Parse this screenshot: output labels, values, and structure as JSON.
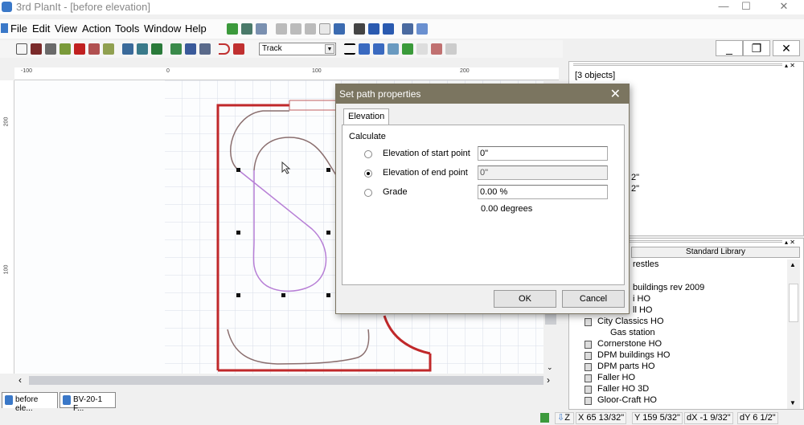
{
  "window": {
    "title": "3rd PlanIt - [before elevation]",
    "minimize": "—",
    "maximize": "☐",
    "close": "✕"
  },
  "menu": [
    "File",
    "Edit",
    "View",
    "Action",
    "Tools",
    "Window",
    "Help"
  ],
  "mdi": {
    "minimize": "_",
    "restore": "❐",
    "close": "✕"
  },
  "toolbar": {
    "layer_select": "Track"
  },
  "ruler": {
    "top": [
      "-100",
      "0",
      "100",
      "200"
    ],
    "left": [
      "200",
      "100"
    ]
  },
  "tabs": [
    "before ele...",
    "BV-20-1 F..."
  ],
  "props": {
    "header": "[3 objects]",
    "partial": [
      "2\"",
      "2\""
    ]
  },
  "library": {
    "title": "Standard Library",
    "items": [
      {
        "label": "restles",
        "child": false
      },
      {
        "label": "buildings rev 2009",
        "child": false
      },
      {
        "label": "i HO",
        "child": false
      },
      {
        "label": "ll HO",
        "child": false
      },
      {
        "label": "City Classics HO",
        "child": false
      },
      {
        "label": "Gas station",
        "child": true
      },
      {
        "label": "Cornerstone HO",
        "child": false
      },
      {
        "label": "DPM buildings HO",
        "child": false
      },
      {
        "label": "DPM parts HO",
        "child": false
      },
      {
        "label": "Faller HO",
        "child": false
      },
      {
        "label": "Faller HO 3D",
        "child": false
      },
      {
        "label": "Gloor-Craft HO",
        "child": false
      }
    ]
  },
  "status": {
    "x": "X 65 13/32\"",
    "y": "Y 159 5/32\"",
    "dx": "dX -1 9/32\"",
    "dy": "dY 6 1/2\"",
    "z": "Z"
  },
  "dialog": {
    "title": "Set path properties",
    "tab": "Elevation",
    "group": "Calculate",
    "rows": [
      {
        "label": "Elevation of start point",
        "value": "0\"",
        "selected": false
      },
      {
        "label": "Elevation of end point",
        "value": "0\"",
        "selected": true
      },
      {
        "label": "Grade",
        "value": "0.00 %",
        "selected": false
      }
    ],
    "degrees": "0.00 degrees",
    "ok": "OK",
    "cancel": "Cancel"
  },
  "colors": {
    "benchwork": "#c0282a",
    "track": "#8a6e6e",
    "selected_track": "#b77fd6",
    "dialog_title": "#7b7560"
  }
}
